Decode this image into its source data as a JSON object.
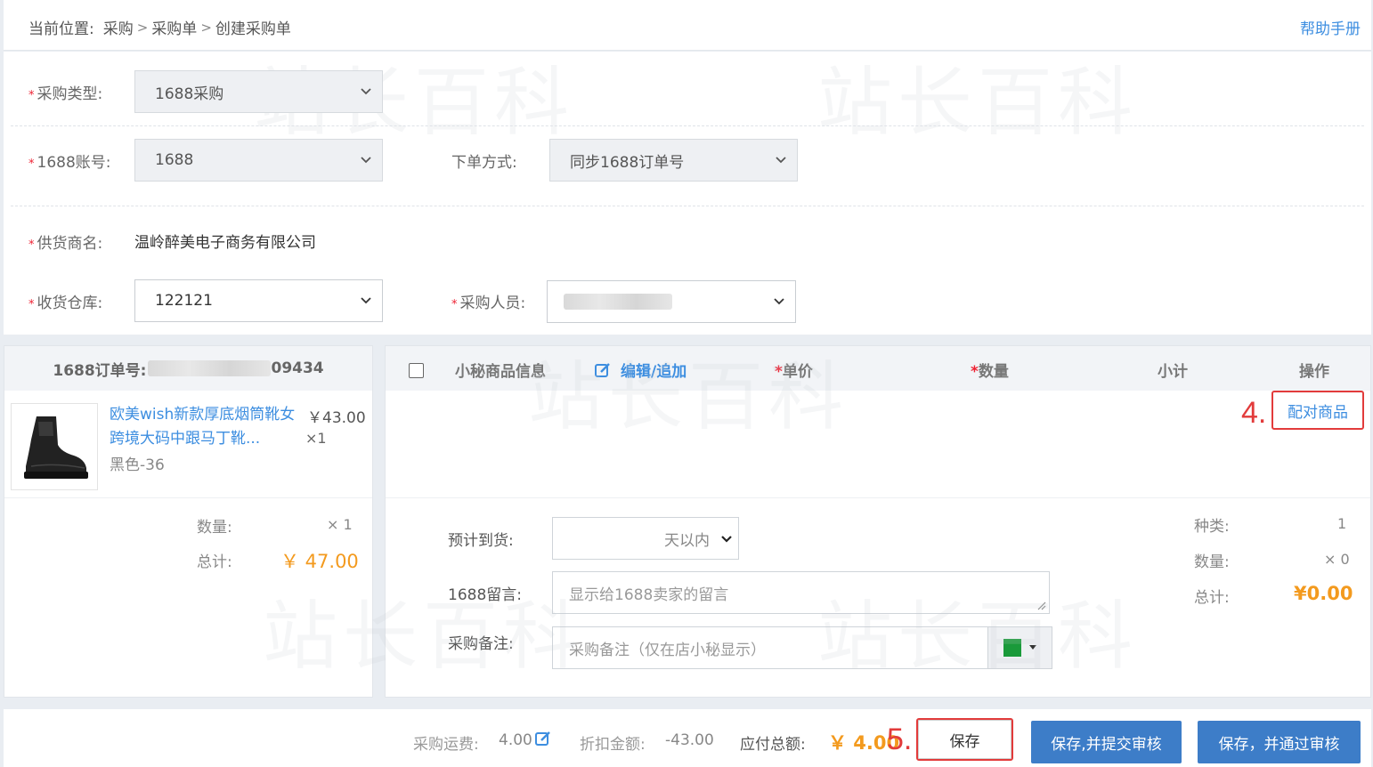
{
  "breadcrumb": {
    "prefix": "当前位置:",
    "items": [
      "采购",
      "采购单",
      "创建采购单"
    ],
    "separator": ">"
  },
  "help_link": "帮助手册",
  "form": {
    "purchase_type": {
      "label": "采购类型:",
      "value": "1688采购"
    },
    "account": {
      "label": "1688账号:",
      "value": "1688"
    },
    "order_method": {
      "label": "下单方式:",
      "value": "同步1688订单号"
    },
    "supplier": {
      "label": "供货商名:",
      "value": "温岭醉美电子商务有限公司"
    },
    "warehouse": {
      "label": "收货仓库:",
      "value": "122121"
    },
    "buyer": {
      "label": "采购人员:",
      "value": ""
    }
  },
  "order_panel": {
    "order_no_label": "1688订单号:",
    "order_no_suffix": "09434",
    "product": {
      "title": "欧美wish新款厚底烟筒靴女跨境大码中跟马丁靴...",
      "variant": "黑色-36",
      "price": "￥43.00",
      "qty": "×1"
    },
    "qty_label": "数量:",
    "qty_value": "× 1",
    "total_label": "总计:",
    "total_value": "￥ 47.00"
  },
  "goods_panel": {
    "headers": {
      "info": "小秘商品信息",
      "edit": "编辑/追加",
      "unit_price": "单价",
      "quantity": "数量",
      "subtotal": "小计",
      "action": "操作"
    },
    "pair_button": "配对商品",
    "step4": "4.",
    "eta_label": "预计到货:",
    "eta_value": "天以内",
    "message_label": "1688留言:",
    "message_placeholder": "显示给1688卖家的留言",
    "note_label": "采购备注:",
    "note_placeholder": "采购备注（仅在店小秘显示）",
    "note_color": "#1a9a3a",
    "summary": {
      "kinds_label": "种类:",
      "kinds_value": "1",
      "qty_label": "数量:",
      "qty_value": "× 0",
      "total_label": "总计:",
      "total_value": "¥0.00"
    }
  },
  "footer": {
    "freight_label": "采购运费:",
    "freight_value": "4.00",
    "discount_label": "折扣金额:",
    "discount_value": "-43.00",
    "payable_label": "应付总额:",
    "payable_value": "￥ 4.00",
    "step5": "5.",
    "save": "保存",
    "save_submit": "保存,并提交审核",
    "save_approve": "保存，并通过审核"
  },
  "watermark": "站长百科",
  "colors": {
    "accent": "#3d8ee0",
    "primary_button": "#3d7dc8",
    "highlight": "#e23b3b",
    "amount": "#f39a1e"
  }
}
